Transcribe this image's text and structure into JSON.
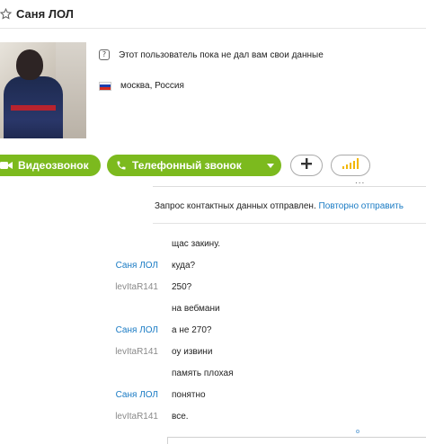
{
  "header": {
    "contact_name": "Саня ЛОЛ",
    "favorite_icon": "star-icon"
  },
  "profile": {
    "avatar_icon": "avatar-photo",
    "privacy_notice": "Этот пользователь пока не дал вам свои данные",
    "location": "москва, Россия",
    "flag_colors": [
      "#ffffff",
      "#1c3fae",
      "#d52b1e"
    ]
  },
  "actions": {
    "video_call_label": "Видеозвонок",
    "phone_call_label": "Телефонный звонок",
    "add_icon": "plus-icon",
    "signal_icon": "signal-bars-icon",
    "more_label": "..."
  },
  "notice": {
    "text": "Запрос контактных данных отправлен. ",
    "link": "Повторно отправить"
  },
  "colors": {
    "accent_green": "#7cba1e",
    "link_blue": "#1a7bc4",
    "self_gray": "#8a8a8a"
  },
  "messages": [
    {
      "sender": "",
      "role": "contact",
      "text": "щас закину."
    },
    {
      "sender": "Саня ЛОЛ",
      "role": "contact",
      "text": "куда?"
    },
    {
      "sender": "levItaR141",
      "role": "self",
      "text": "250?"
    },
    {
      "sender": "",
      "role": "self",
      "text": "на вебмани"
    },
    {
      "sender": "Саня ЛОЛ",
      "role": "contact",
      "text": "а не 270?"
    },
    {
      "sender": "levItaR141",
      "role": "self",
      "text": "оу извини"
    },
    {
      "sender": "",
      "role": "self",
      "text": "память плохая"
    },
    {
      "sender": "Саня ЛОЛ",
      "role": "contact",
      "text": "понятно"
    },
    {
      "sender": "levItaR141",
      "role": "self",
      "text": "все."
    }
  ]
}
